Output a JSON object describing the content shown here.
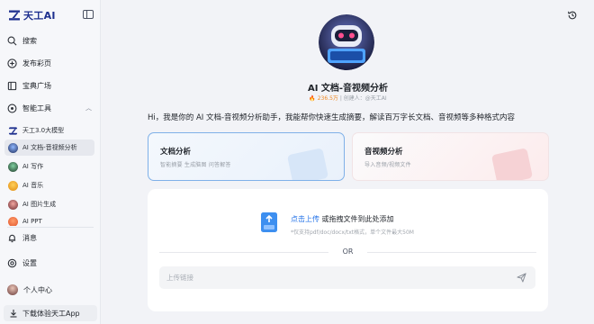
{
  "brand": {
    "name": "天工AI",
    "color": "#1d2f8e"
  },
  "nav": {
    "search": "搜索",
    "publish": "发布彩页",
    "treasure": "宝典广场",
    "tools": "智能工具",
    "messages": "消息",
    "settings": "设置",
    "profile": "个人中心"
  },
  "tools": [
    {
      "label": "天工3.0大模型",
      "icon": "tiangong-logo-icon"
    },
    {
      "label": "AI 文档-音视频分析",
      "icon": "doc-analysis-avatar",
      "active": true
    },
    {
      "label": "AI 写作",
      "icon": "writing-avatar"
    },
    {
      "label": "AI 音乐",
      "icon": "music-avatar"
    },
    {
      "label": "AI 图片生成",
      "icon": "image-gen-avatar"
    },
    {
      "label": "AI PPT",
      "icon": "ppt-avatar"
    }
  ],
  "download": "下载体验天工App",
  "agent": {
    "title": "AI 文档-音视频分析",
    "uses": "🔥 236.5万",
    "meta_sep1": " | ",
    "meta_creator": "创建人：@天工AI"
  },
  "greeting": "Hi，我是你的 AI 文档-音视频分析助手，我能帮你快速生成摘要，解读百万字长文档、音视频等多种格式内容",
  "cards": [
    {
      "title": "文档分析",
      "sub": "智能摘要   生成脑图   问答解答"
    },
    {
      "title": "音视频分析",
      "sub": "导入音频/视频文件"
    }
  ],
  "upload": {
    "action": "点击上传",
    "action_rest": " 或拖拽文件到此处添加",
    "hint": "*仅支持pdf/doc/docx/txt格式，单个文件最大50M",
    "or": "OR",
    "url_placeholder": "上传链接",
    "accent": "#2473e8"
  }
}
